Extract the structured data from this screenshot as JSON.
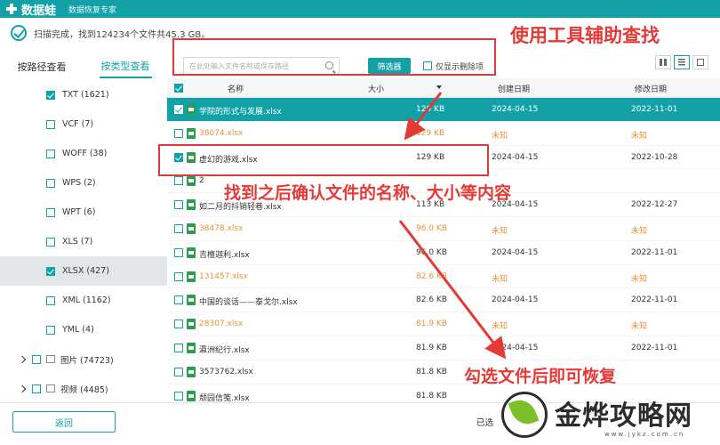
{
  "title_bar": {
    "app_name": "数据蛙",
    "subtitle": "数据恢复专家"
  },
  "scan": {
    "status": "扫描完成，找到124234个文件共45.3 GB。"
  },
  "tabs": [
    "按路径查看",
    "按类型查看"
  ],
  "search": {
    "placeholder": "在此处输入文件名称或保存路径",
    "filter_label": "筛选器",
    "show_deleted_label": "仅显示删除项"
  },
  "sidebar": {
    "items": [
      {
        "label": "TXT (1621)",
        "checked": true
      },
      {
        "label": "VCF (7)",
        "checked": false
      },
      {
        "label": "WOFF (38)",
        "checked": false
      },
      {
        "label": "WPS (2)",
        "checked": false
      },
      {
        "label": "WPT (6)",
        "checked": false
      },
      {
        "label": "XLS (7)",
        "checked": false
      },
      {
        "label": "XLSX (427)",
        "checked": true
      },
      {
        "label": "XML (1162)",
        "checked": false
      },
      {
        "label": "YML (4)",
        "checked": false
      }
    ],
    "groups": [
      {
        "label": "图片 (74723)"
      },
      {
        "label": "视频 (4485)"
      }
    ]
  },
  "table": {
    "headers": {
      "name": "名称",
      "size": "大小",
      "created": "创建日期",
      "modified": "修改日期"
    },
    "rows": [
      {
        "name": "学院的形式与发展.xlsx",
        "size": "129 KB",
        "created": "2024-04-15",
        "modified": "2022-11-01"
      },
      {
        "name": "38074.xlsx",
        "size": "129 KB",
        "created": "未知",
        "modified": "未知"
      },
      {
        "name": "虚幻的游戏.xlsx",
        "size": "129 KB",
        "created": "2024-04-15",
        "modified": "2022-10-28"
      },
      {
        "name": "2",
        "size": "",
        "created": "",
        "modified": ""
      },
      {
        "name": "如二月的抖销轻巷.xlsx",
        "size": "113 KB",
        "created": "2024-04-15",
        "modified": "2022-12-27"
      },
      {
        "name": "38478.xlsx",
        "size": "96.0 KB",
        "created": "未知",
        "modified": "未知"
      },
      {
        "name": "吉檀迦利.xlsx",
        "size": "96.0 KB",
        "created": "2024-04-15",
        "modified": "2022-11-01"
      },
      {
        "name": "131457.xlsx",
        "size": "82.6 KB",
        "created": "未知",
        "modified": "未知"
      },
      {
        "name": "中国的谈话——泰戈尔.xlsx",
        "size": "82.6 KB",
        "created": "2024-04-15",
        "modified": "2022-11-01"
      },
      {
        "name": "28307.xlsx",
        "size": "81.9 KB",
        "created": "未知",
        "modified": "未知"
      },
      {
        "name": "瀛洲纪行.xlsx",
        "size": "81.9 KB",
        "created": "2024-04-15",
        "modified": "2022-11-01"
      },
      {
        "name": "3573762.xlsx",
        "size": "81.8 KB",
        "created": "",
        "modified": ""
      },
      {
        "name": "颓园信笺.xlsx",
        "size": "81.8 KB",
        "created": "",
        "modified": ""
      }
    ]
  },
  "annotations": {
    "tools": "使用工具辅助查找",
    "confirm": "找到之后确认文件的名称、大小等内容",
    "recover": "勾选文件后即可恢复"
  },
  "bottom": {
    "back_label": "返回",
    "selected_label": "已选"
  },
  "watermark": {
    "text": "金烨攻略网",
    "url": "www.jykz.com.cn"
  },
  "colors": {
    "accent": "#11a1a7",
    "annotation": "#e53935",
    "unknown": "#e8923a"
  }
}
